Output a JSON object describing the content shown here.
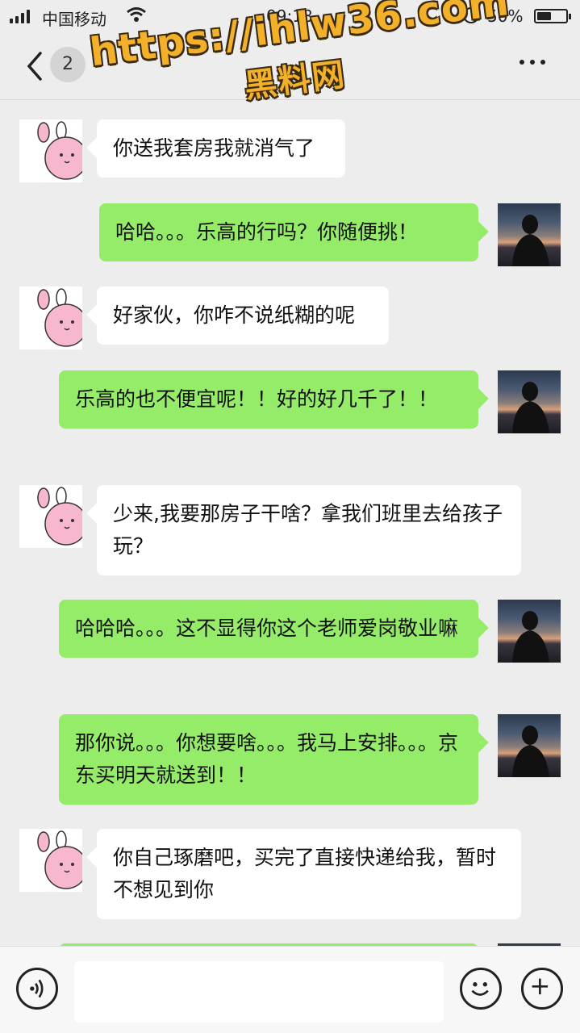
{
  "status_bar": {
    "carrier": "中国移动",
    "time": "09:18",
    "battery_percent": "50%",
    "battery_level": 0.5
  },
  "nav": {
    "back_count": "2",
    "title": "",
    "more_icon": "more-dots-icon"
  },
  "watermark": {
    "url": "https://ihlw36.com",
    "site_name": "黑料网"
  },
  "messages": [
    {
      "side": "left",
      "text": "你送我套房我就消气了"
    },
    {
      "side": "right",
      "text": "哈哈。。。乐高的行吗？你随便挑！"
    },
    {
      "side": "left",
      "text": "好家伙，你咋不说纸糊的呢"
    },
    {
      "side": "right",
      "text": "乐高的也不便宜呢！！好的好几千了！！"
    },
    {
      "side": "left",
      "text": "少来,我要那房子干啥？拿我们班里去给孩子玩？"
    },
    {
      "side": "right",
      "text": "哈哈哈。。。这不显得你这个老师爱岗敬业嘛"
    },
    {
      "side": "right",
      "text": "那你说。。。你想要啥。。。我马上安排。。。京东买明天就送到！！"
    },
    {
      "side": "left",
      "text": "你自己琢磨吧，买完了直接快递给我，暂时不想见到你"
    }
  ],
  "input_bar": {
    "voice_icon": "voice-icon",
    "input_value": "",
    "emoji_icon": "emoji-icon",
    "plus_icon": "plus-icon"
  },
  "colors": {
    "sent_bubble": "#95ec69",
    "received_bubble": "#ffffff",
    "background": "#ededed"
  }
}
